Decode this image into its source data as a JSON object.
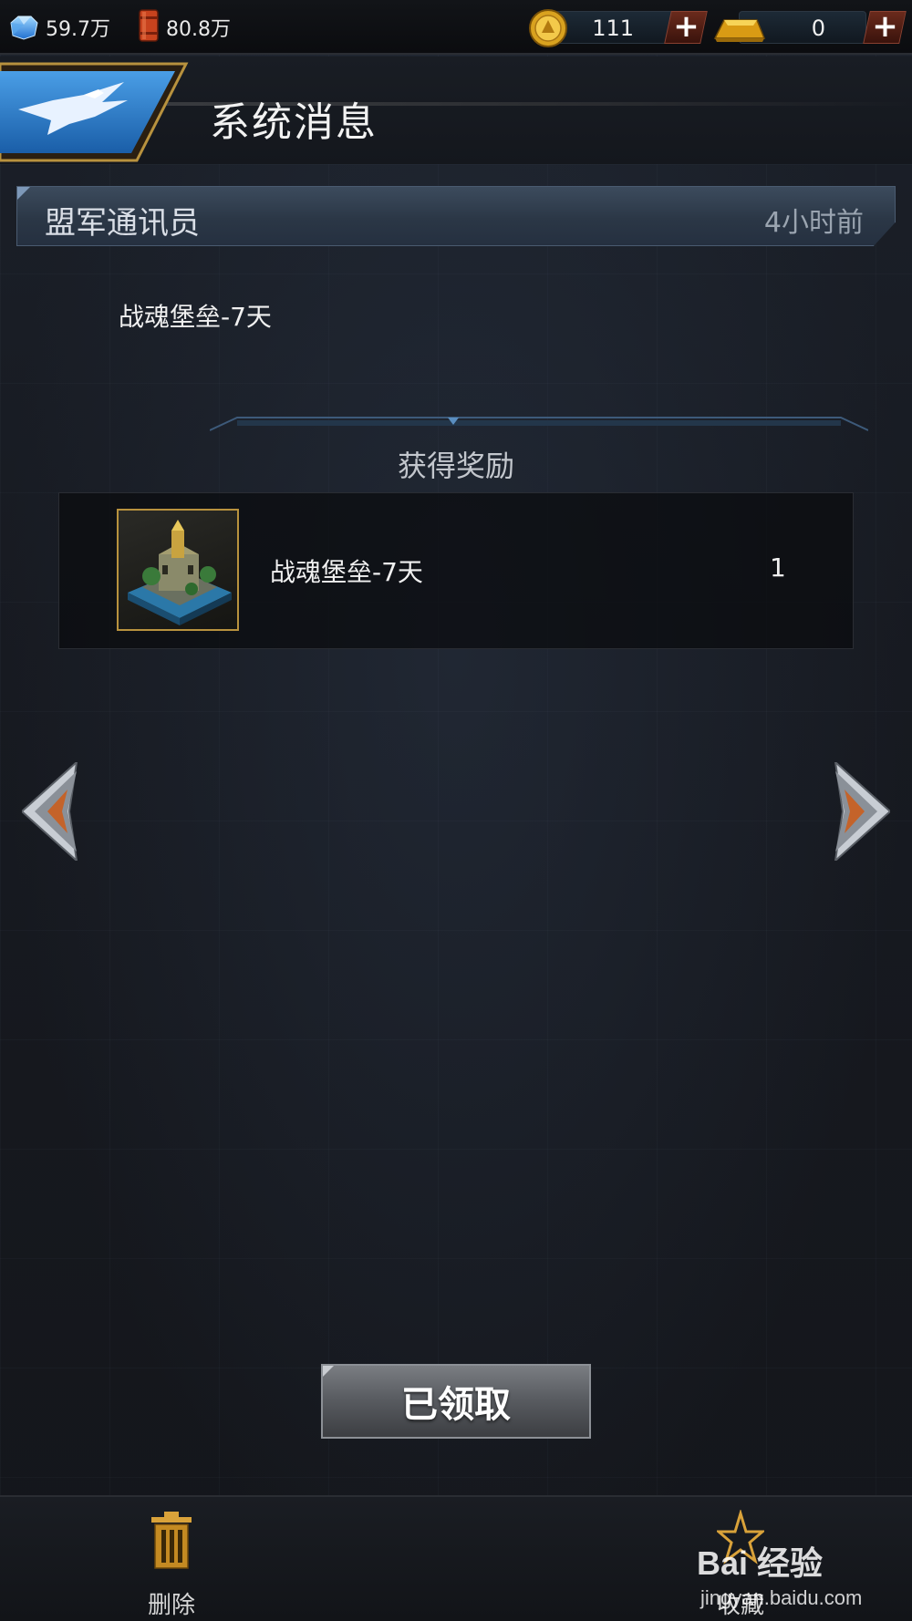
{
  "resources": {
    "crystal": {
      "icon": "crystal-icon",
      "value": "59.7万"
    },
    "oil": {
      "icon": "oil-barrel-icon",
      "value": "80.8万"
    }
  },
  "currencies": {
    "gold_coin": {
      "icon": "gold-coin-icon",
      "value": "111"
    },
    "gold_bar": {
      "icon": "gold-bar-icon",
      "value": "0"
    },
    "add_label": "+"
  },
  "header": {
    "title": "系统消息",
    "emblem_icon": "eagle-emblem-icon"
  },
  "message": {
    "sender": "盟军通讯员",
    "time": "4小时前",
    "body": "战魂堡垒-7天"
  },
  "rewards": {
    "title": "获得奖励",
    "items": [
      {
        "name": "战魂堡垒-7天",
        "quantity": "1",
        "icon": "fortress-icon"
      }
    ]
  },
  "claim_button": {
    "label": "已领取"
  },
  "bottom_bar": {
    "delete": {
      "label": "删除",
      "icon": "trash-icon"
    },
    "favorite": {
      "label": "收藏",
      "icon": "star-icon"
    }
  },
  "watermark": {
    "main": "Bai 经验",
    "sub": "jingyan.baidu.com"
  },
  "colors": {
    "background": "#14171d",
    "accent_gold": "#b8923e",
    "plus_button": "#6a2a1c",
    "sender_bar": "#2b3746"
  }
}
